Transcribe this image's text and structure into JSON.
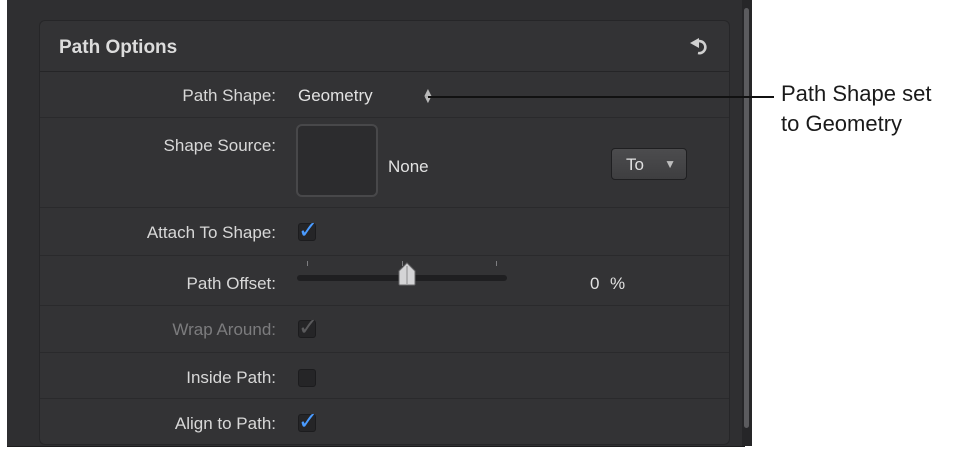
{
  "panel": {
    "title": "Path Options"
  },
  "fields": {
    "path_shape": {
      "label": "Path Shape:",
      "value": "Geometry"
    },
    "shape_source": {
      "label": "Shape Source:",
      "value": "None",
      "button": "To"
    },
    "attach_to_shape": {
      "label": "Attach To Shape:",
      "checked": true
    },
    "path_offset": {
      "label": "Path Offset:",
      "value": "0",
      "unit": "%"
    },
    "wrap_around": {
      "label": "Wrap Around:",
      "checked": true,
      "enabled": false
    },
    "inside_path": {
      "label": "Inside Path:",
      "checked": false
    },
    "align_to_path": {
      "label": "Align to Path:",
      "checked": true
    }
  },
  "callout": {
    "line1": "Path Shape set",
    "line2": "to Geometry"
  },
  "icons": {
    "reset": "reset-arrow-icon",
    "popup": "up-down-arrows-icon",
    "dropdown": "chevron-down-icon",
    "check": "check-icon"
  },
  "colors": {
    "accent": "#4a9bff",
    "panel": "#333335",
    "frame": "#2f2f31"
  }
}
